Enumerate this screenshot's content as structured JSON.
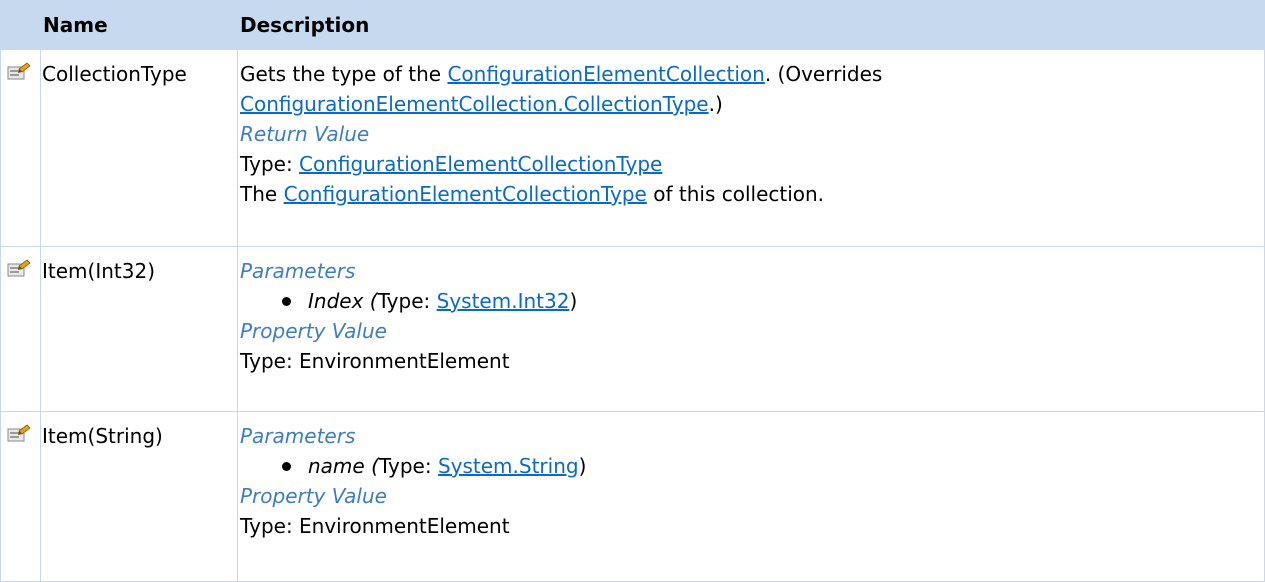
{
  "table": {
    "headers": {
      "name": "Name",
      "description": "Description"
    },
    "icon": "property-icon",
    "rows": [
      {
        "name": "CollectionType",
        "summary": {
          "prefix": "Gets the type of the ",
          "link1": "ConfigurationElementCollection",
          "middle": ". (Overrides",
          "link2": "ConfigurationElementCollection.CollectionType",
          "suffix": ".)"
        },
        "return_heading": "Return Value",
        "type_prefix": "Type: ",
        "type_link": "ConfigurationElementCollectionType",
        "desc_prefix": "The ",
        "desc_link": "ConfigurationElementCollectionType",
        "desc_suffix": " of this collection."
      },
      {
        "name": "Item(Int32)",
        "params_heading": "Parameters",
        "param_name": "Index (",
        "param_type_prefix": "Type: ",
        "param_type_link": "System.Int32",
        "param_close": ")",
        "value_heading": "Property Value",
        "value_type": "Type: EnvironmentElement"
      },
      {
        "name": "Item(String)",
        "params_heading": "Parameters",
        "param_name": "name (",
        "param_type_prefix": "Type: ",
        "param_type_link": "System.String",
        "param_close": ")",
        "value_heading": "Property Value",
        "value_type": "Type: EnvironmentElement"
      }
    ]
  }
}
